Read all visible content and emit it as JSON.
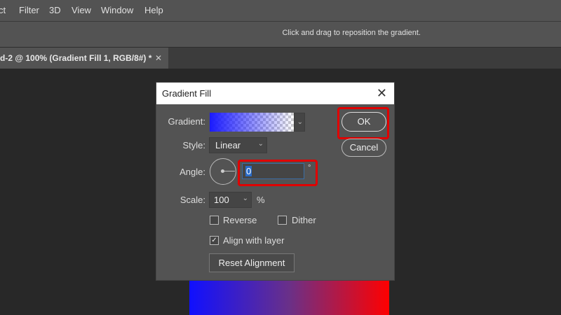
{
  "menu": [
    "ct",
    "Filter",
    "3D",
    "View",
    "Window",
    "Help"
  ],
  "options": {
    "hint": "Click and drag to reposition the gradient."
  },
  "tab": {
    "title": "d-2 @ 100% (Gradient Fill 1, RGB/8#) *",
    "close": "✕"
  },
  "dialog": {
    "title": "Gradient Fill",
    "close": "✕",
    "gradient_label": "Gradient:",
    "style_label": "Style:",
    "style_value": "Linear",
    "angle_label": "Angle:",
    "angle_value": "0",
    "degree": "°",
    "scale_label": "Scale:",
    "scale_value": "100",
    "percent": "%",
    "reverse": "Reverse",
    "dither": "Dither",
    "align": "Align with layer",
    "reset": "Reset Alignment",
    "ok": "OK",
    "cancel": "Cancel",
    "checks": {
      "reverse": false,
      "dither": false,
      "align": true
    }
  },
  "colors": {
    "highlight": "#e00000"
  }
}
